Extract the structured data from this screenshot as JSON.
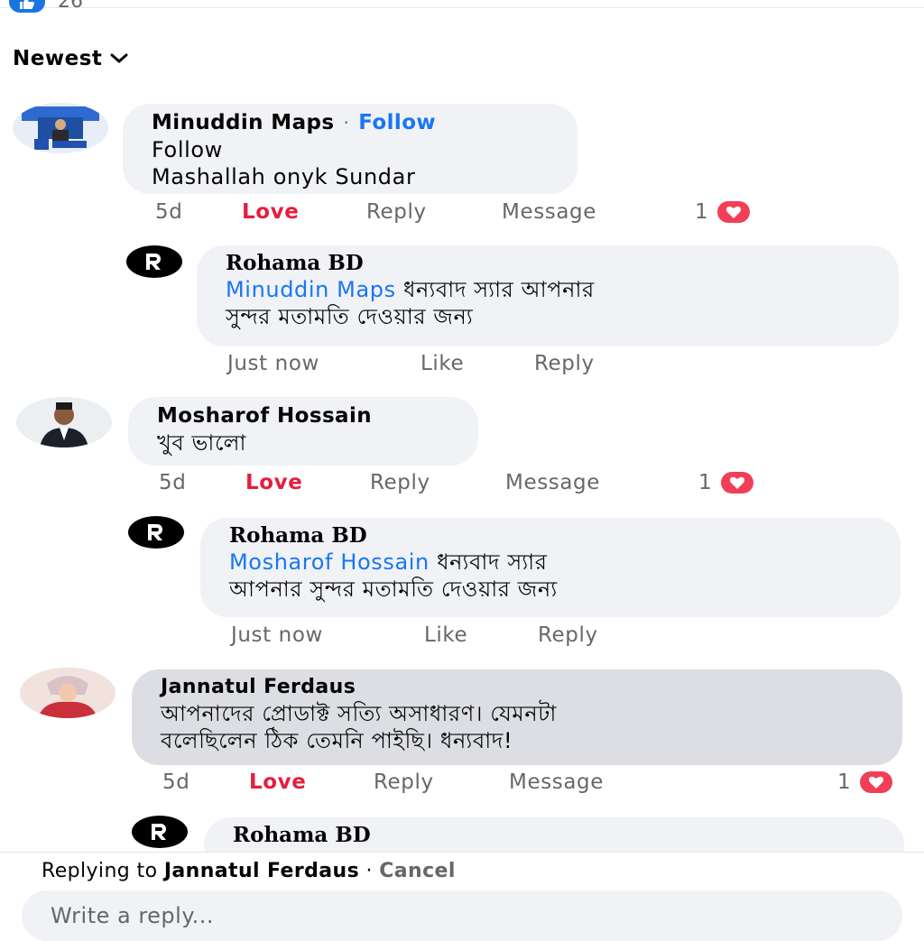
{
  "reactions": {
    "like_count": "26"
  },
  "sort": {
    "label": "Newest"
  },
  "comments": [
    {
      "author": "Minuddin Maps",
      "follow_sep": "·",
      "follow": "Follow",
      "text1": "Follow",
      "text2": "Mashallah onyk Sundar",
      "time": "5d",
      "love": "Love",
      "reply": "Reply",
      "message": "Message",
      "reaction_count": "1",
      "reply_item": {
        "author": "Rohama BD",
        "mention": "Minuddin Maps",
        "text1": " ধন্যবাদ স্যার আপনার",
        "text2": "সুন্দর মতামতি দেওয়ার জন্য",
        "time": "Just now",
        "like": "Like",
        "reply": "Reply"
      }
    },
    {
      "author": "Mosharof Hossain",
      "text1": "খুব ভালো",
      "time": "5d",
      "love": "Love",
      "reply": "Reply",
      "message": "Message",
      "reaction_count": "1",
      "reply_item": {
        "author": "Rohama BD",
        "mention": "Mosharof Hossain",
        "text1": " ধন্যবাদ স্যার",
        "text2": "আপনার সুন্দর মতামতি দেওয়ার জন্য",
        "time": "Just now",
        "like": "Like",
        "reply": "Reply"
      }
    },
    {
      "author": "Jannatul Ferdaus",
      "text1": "আপনাদের প্রোডাক্ট সত্যি অসাধারণ। যেমনটা",
      "text2": "বলেছিলেন ঠিক তেমনি পাইছি। ধন্যবাদ!",
      "time": "5d",
      "love": "Love",
      "reply": "Reply",
      "message": "Message",
      "reaction_count": "1",
      "reply_item": {
        "author": "Rohama BD"
      }
    }
  ],
  "reply_bar": {
    "replying_prefix": "Replying to ",
    "replying_to": "Jannatul Ferdaus",
    "separator": " · ",
    "cancel": "Cancel",
    "placeholder": "Write a reply..."
  },
  "colors": {
    "accent": "#1877f2",
    "love": "#e41e3f",
    "bubble": "#f0f2f5",
    "heart": "#f33e58"
  },
  "icons": [
    "like-icon",
    "chevron-down-icon",
    "heart-icon",
    "rohama-logo-icon"
  ]
}
